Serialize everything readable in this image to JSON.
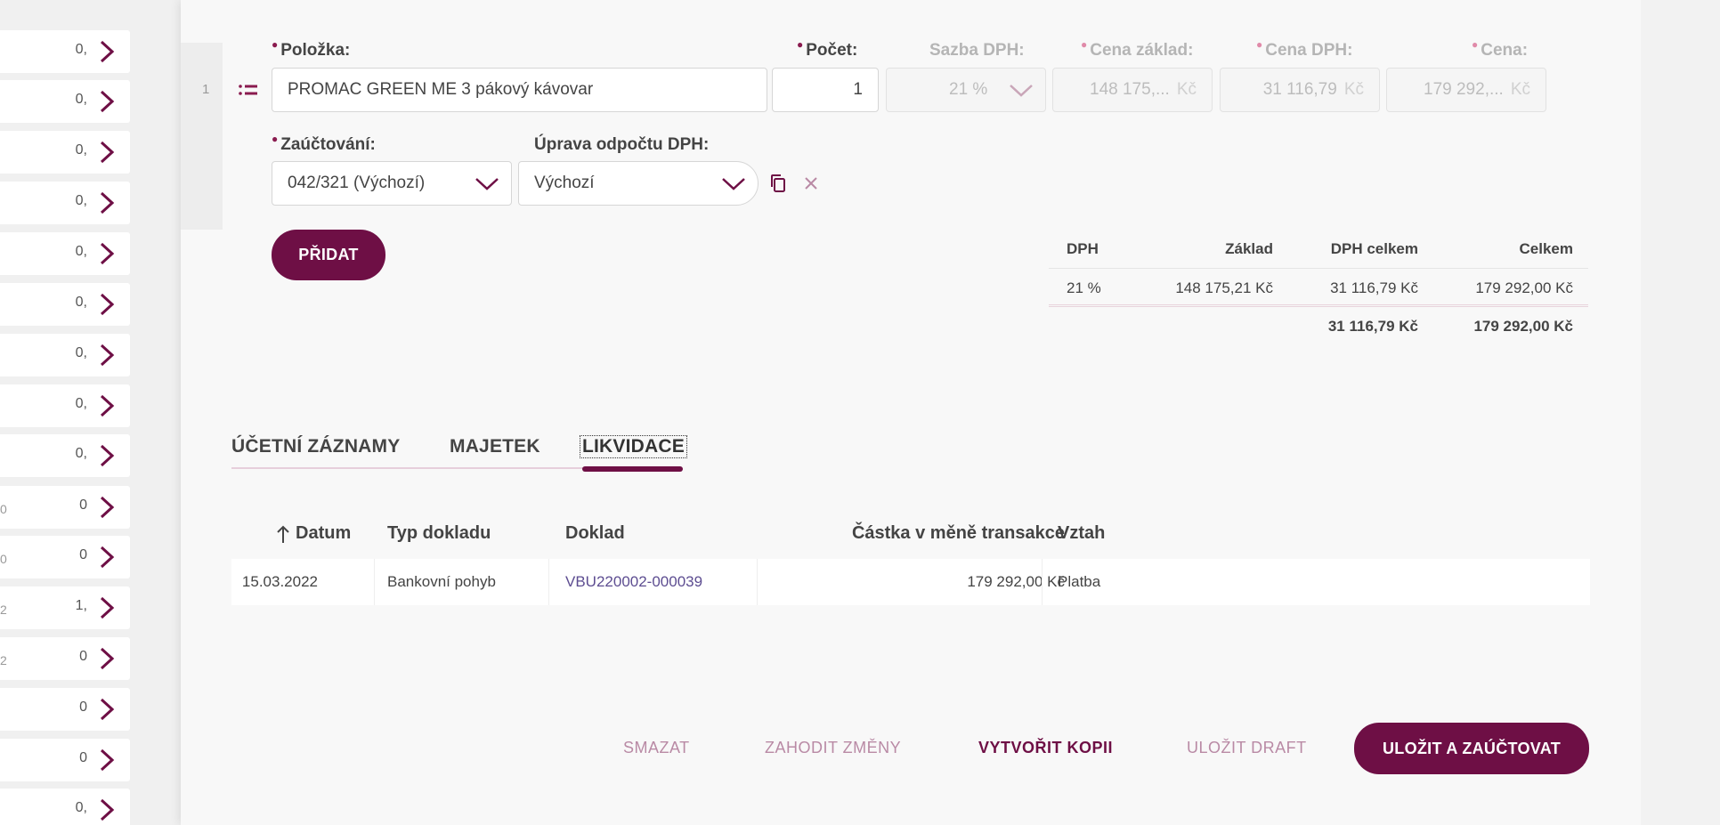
{
  "left_list": {
    "rows": [
      {
        "edge": "",
        "value": "0,"
      },
      {
        "edge": "",
        "value": "0,"
      },
      {
        "edge": "",
        "value": "0,"
      },
      {
        "edge": "",
        "value": "0,"
      },
      {
        "edge": "",
        "value": "0,"
      },
      {
        "edge": "",
        "value": "0,"
      },
      {
        "edge": "",
        "value": "0,"
      },
      {
        "edge": "",
        "value": "0,"
      },
      {
        "edge": "",
        "value": "0,"
      },
      {
        "edge": "0",
        "value": "0"
      },
      {
        "edge": "0",
        "value": "0"
      },
      {
        "edge": "2",
        "value": "1,"
      },
      {
        "edge": "2",
        "value": "0"
      },
      {
        "edge": "",
        "value": "0"
      },
      {
        "edge": "",
        "value": "0"
      },
      {
        "edge": "",
        "value": "0,"
      }
    ]
  },
  "item": {
    "row_number": "1",
    "labels": {
      "polozka": "Položka:",
      "pocet": "Počet:",
      "sazba": "Sazba DPH:",
      "cena_zaklad": "Cena základ:",
      "cena_dph": "Cena DPH:",
      "cena": "Cena:",
      "zauctovani": "Zaúčtování:",
      "uprava": "Úprava odpočtu DPH:"
    },
    "values": {
      "polozka": "PROMAC GREEN ME 3 pákový kávovar",
      "pocet": "1",
      "sazba": "21 %",
      "cena_zaklad": "148 175,...",
      "cena_dph": "31 116,79",
      "cena": "179 292,...",
      "currency": "Kč",
      "zauctovani": "042/321 (Výchozí)",
      "uprava": "Výchozí"
    },
    "add_button": "PŘIDAT"
  },
  "vat_summary": {
    "headers": [
      "DPH",
      "Základ",
      "DPH celkem",
      "Celkem"
    ],
    "row": [
      "21 %",
      "148 175,21 Kč",
      "31 116,79 Kč",
      "179 292,00 Kč"
    ],
    "totals": [
      "",
      "",
      "31 116,79 Kč",
      "179 292,00 Kč"
    ]
  },
  "tabs": {
    "items": [
      "ÚČETNÍ ZÁZNAMY",
      "MAJETEK",
      "LIKVIDACE"
    ],
    "active": "LIKVIDACE"
  },
  "likvidace_table": {
    "headers": [
      "Datum",
      "Typ dokladu",
      "Doklad",
      "Částka v měně transakce",
      "Vztah"
    ],
    "rows": [
      {
        "datum": "15.03.2022",
        "typ": "Bankovní pohyb",
        "doklad": "VBU220002-000039",
        "castka": "179 292,00 Kč",
        "vztah": "Platba"
      }
    ]
  },
  "actions": {
    "smazat": "SMAZAT",
    "zahodit": "ZAHODIT ZMĚNY",
    "kopie": "VYTVOŘIT KOPII",
    "draft": "ULOŽIT DRAFT",
    "ulozit": "ULOŽIT A ZAÚČTOVAT"
  },
  "colors": {
    "brand": "#6e0f45",
    "link": "#5d4d91",
    "required": "#8a1b4f"
  }
}
